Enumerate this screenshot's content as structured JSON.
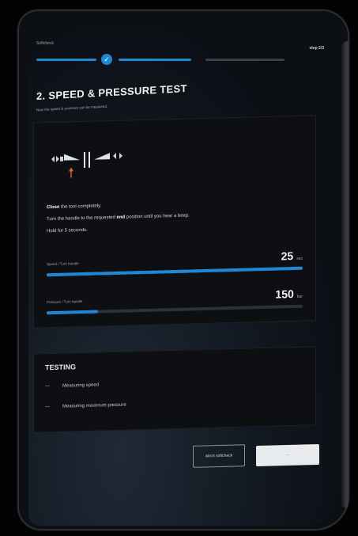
{
  "stepper": {
    "label": "Softcheck",
    "step_count": "step 2/3",
    "done_glyph": "✓"
  },
  "header": {
    "title": "2. SPEED & PRESSURE TEST",
    "subtitle": "Now the speed & pressure can be measured."
  },
  "instructions": {
    "line1_bold": "Close",
    "line1_rest": " the tool completely.",
    "line2_pre": "Turn the handle to the requested ",
    "line2_bold": "end",
    "line2_post": " position until you hear a beep.",
    "line3": "Hold for 5 seconds."
  },
  "meters": [
    {
      "label": "Speed / Turn handle",
      "value": "25",
      "unit": "sec",
      "progress": 1.0
    },
    {
      "label": "Pressure / Turn handle",
      "value": "150",
      "unit": "bar",
      "progress": 0.2
    }
  ],
  "testing": {
    "title": "TESTING",
    "items": [
      "Measuring speed",
      "Measuring maximum pressure"
    ]
  },
  "buttons": {
    "abort": "Abort softcheck",
    "next": "—"
  },
  "colors": {
    "accent": "#1e88d6",
    "arrow": "#e0642a"
  }
}
